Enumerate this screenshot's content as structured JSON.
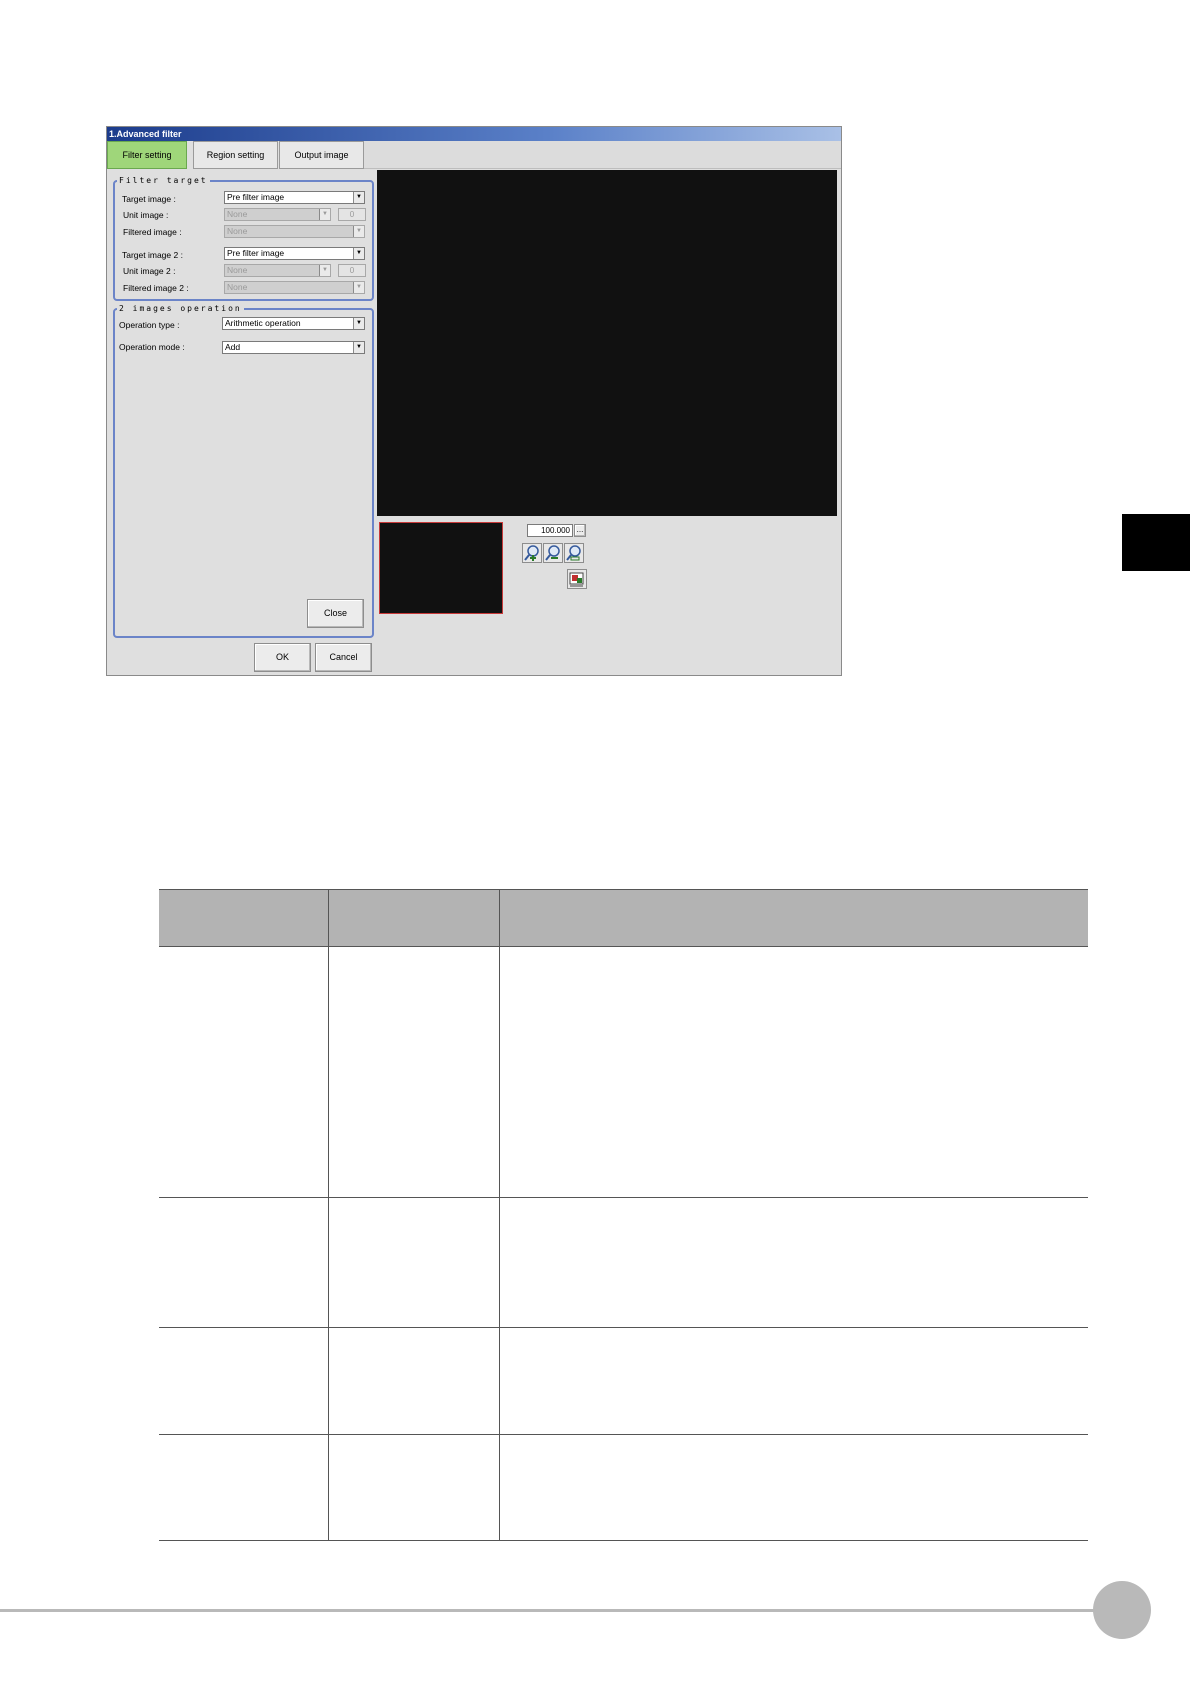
{
  "window": {
    "title": "1.Advanced filter"
  },
  "tabs": [
    {
      "label": "Filter setting",
      "active": true
    },
    {
      "label": "Region setting",
      "active": false
    },
    {
      "label": "Output image",
      "active": false
    }
  ],
  "filter_target": {
    "legend": "Filter target",
    "target_image": {
      "label": "Target image :",
      "value": "Pre filter image"
    },
    "unit_image": {
      "label": "Unit image :",
      "value": "None",
      "spin": "0"
    },
    "filtered_image": {
      "label": "Filtered image :",
      "value": "None"
    },
    "target_image2": {
      "label": "Target image 2 :",
      "value": "Pre filter image"
    },
    "unit_image2": {
      "label": "Unit image 2 :",
      "value": "None",
      "spin": "0"
    },
    "filtered_image2": {
      "label": "Filtered image 2 :",
      "value": "None"
    }
  },
  "images_operation": {
    "legend": "2 images operation",
    "operation_type": {
      "label": "Operation type :",
      "value": "Arithmetic operation"
    },
    "operation_mode": {
      "label": "Operation mode :",
      "value": "Add"
    },
    "close_label": "Close"
  },
  "buttons": {
    "ok": "OK",
    "cancel": "Cancel"
  },
  "zoom": {
    "value": "100.000",
    "more": "..."
  },
  "icons": [
    "zoom-in-icon",
    "zoom-out-icon",
    "zoom-fit-icon",
    "display-fit-icon"
  ],
  "colors": {
    "active_tab": "#9fd67a",
    "group_border": "#6b84c8",
    "title_bar": "#1c3c8c"
  }
}
